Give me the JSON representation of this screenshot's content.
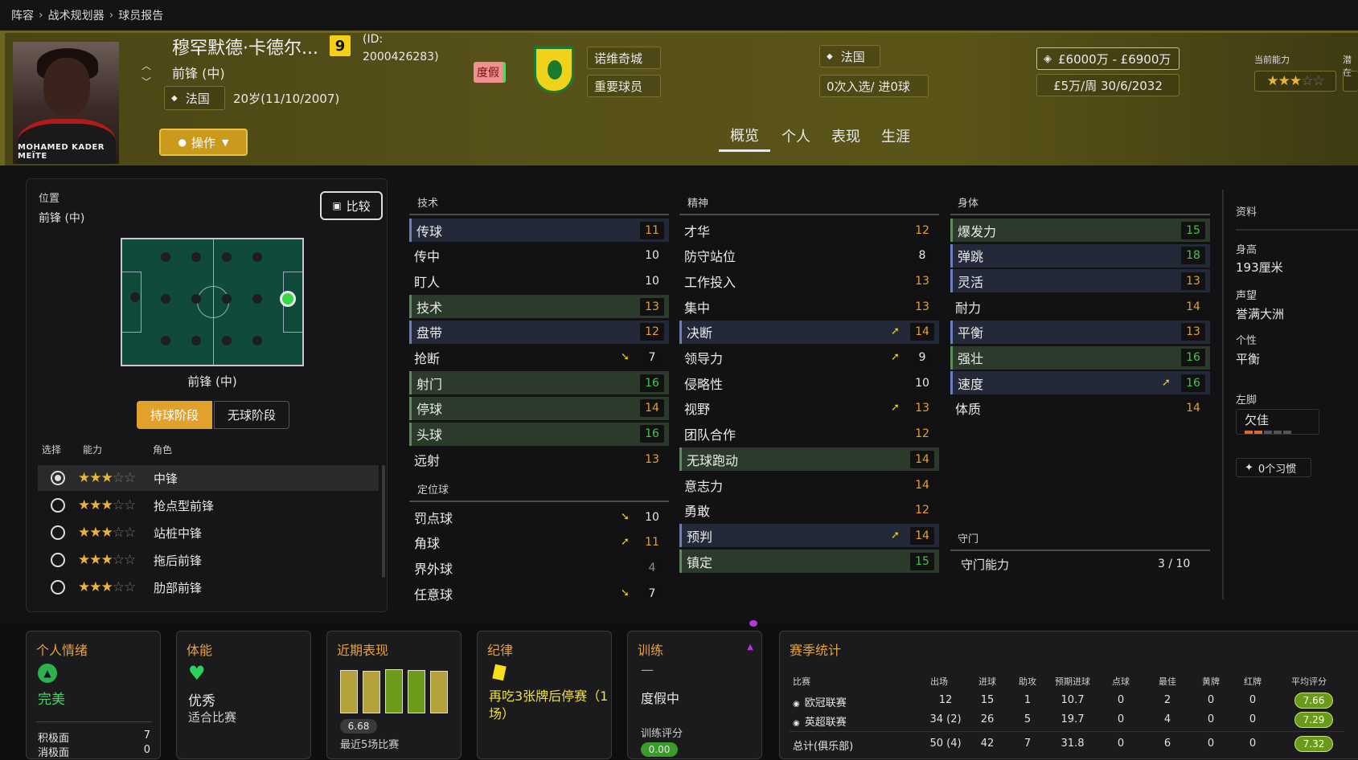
{
  "breadcrumb": [
    "阵容",
    "战术规划器",
    "球员报告"
  ],
  "player": {
    "name": "穆罕默德·卡德尔...",
    "number": "9",
    "id_label": "(ID:",
    "id_value": "2000426283)",
    "position": "前锋 (中)",
    "nation": "法国",
    "age": "20岁(11/10/2007)",
    "status_tag": "度假",
    "photo_caption": "MOHAMED KADER MEÏTE"
  },
  "club": {
    "name": "诺维奇城",
    "role": "重要球员"
  },
  "nation_box": {
    "country": "法国",
    "caps": "0次入选/ 进0球"
  },
  "value": {
    "range": "£6000万 - £6900万",
    "contract": "£5万/周 30/6/2032"
  },
  "ability": {
    "current_label": "当前能力",
    "potential_label": "潜在",
    "current_stars": 3
  },
  "action_button": "操作",
  "tabs": [
    "概览",
    "个人",
    "表现",
    "生涯"
  ],
  "left_panel": {
    "position_label": "位置",
    "position_value": "前锋 (中)",
    "compare_button": "比较",
    "pitch_label": "前锋 (中)",
    "phase_tabs": [
      "持球阶段",
      "无球阶段"
    ],
    "col_headers": [
      "选择",
      "能力",
      "角色"
    ],
    "roles": [
      {
        "name": "中锋",
        "stars": 3,
        "selected": true
      },
      {
        "name": "抢点型前锋",
        "stars": 3,
        "selected": false
      },
      {
        "name": "站桩中锋",
        "stars": 3,
        "selected": false
      },
      {
        "name": "拖后前锋",
        "stars": 3,
        "selected": false
      },
      {
        "name": "肋部前锋",
        "stars": 3,
        "selected": false
      }
    ]
  },
  "technical": {
    "title": "技术",
    "rows": [
      {
        "name": "传球",
        "value": "11",
        "hl": "blue",
        "arrow": ""
      },
      {
        "name": "传中",
        "value": "10",
        "hl": "",
        "arrow": ""
      },
      {
        "name": "盯人",
        "value": "10",
        "hl": "",
        "arrow": ""
      },
      {
        "name": "技术",
        "value": "13",
        "hl": "green",
        "arrow": ""
      },
      {
        "name": "盘带",
        "value": "12",
        "hl": "blue",
        "arrow": ""
      },
      {
        "name": "抢断",
        "value": "7",
        "hl": "",
        "arrow": "down"
      },
      {
        "name": "射门",
        "value": "16",
        "hl": "green",
        "arrow": ""
      },
      {
        "name": "停球",
        "value": "14",
        "hl": "green",
        "arrow": ""
      },
      {
        "name": "头球",
        "value": "16",
        "hl": "green",
        "arrow": ""
      },
      {
        "name": "远射",
        "value": "13",
        "hl": "",
        "arrow": ""
      }
    ]
  },
  "set_pieces": {
    "title": "定位球",
    "rows": [
      {
        "name": "罚点球",
        "value": "10",
        "hl": "",
        "arrow": "down"
      },
      {
        "name": "角球",
        "value": "11",
        "hl": "",
        "arrow": "up"
      },
      {
        "name": "界外球",
        "value": "4",
        "hl": "",
        "arrow": ""
      },
      {
        "name": "任意球",
        "value": "7",
        "hl": "",
        "arrow": "down"
      }
    ]
  },
  "mental": {
    "title": "精神",
    "rows": [
      {
        "name": "才华",
        "value": "12",
        "hl": "",
        "arrow": ""
      },
      {
        "name": "防守站位",
        "value": "8",
        "hl": "",
        "arrow": ""
      },
      {
        "name": "工作投入",
        "value": "13",
        "hl": "",
        "arrow": ""
      },
      {
        "name": "集中",
        "value": "13",
        "hl": "",
        "arrow": ""
      },
      {
        "name": "决断",
        "value": "14",
        "hl": "blue",
        "arrow": "up"
      },
      {
        "name": "领导力",
        "value": "9",
        "hl": "",
        "arrow": "up"
      },
      {
        "name": "侵略性",
        "value": "10",
        "hl": "",
        "arrow": ""
      },
      {
        "name": "视野",
        "value": "13",
        "hl": "",
        "arrow": "up"
      },
      {
        "name": "团队合作",
        "value": "12",
        "hl": "",
        "arrow": ""
      },
      {
        "name": "无球跑动",
        "value": "14",
        "hl": "green",
        "arrow": ""
      },
      {
        "name": "意志力",
        "value": "14",
        "hl": "",
        "arrow": ""
      },
      {
        "name": "勇敢",
        "value": "12",
        "hl": "",
        "arrow": ""
      },
      {
        "name": "预判",
        "value": "14",
        "hl": "blue",
        "arrow": "up"
      },
      {
        "name": "镇定",
        "value": "15",
        "hl": "green",
        "arrow": ""
      }
    ]
  },
  "physical": {
    "title": "身体",
    "rows": [
      {
        "name": "爆发力",
        "value": "15",
        "hl": "green",
        "arrow": ""
      },
      {
        "name": "弹跳",
        "value": "18",
        "hl": "blue",
        "arrow": ""
      },
      {
        "name": "灵活",
        "value": "13",
        "hl": "blue",
        "arrow": ""
      },
      {
        "name": "耐力",
        "value": "14",
        "hl": "",
        "arrow": ""
      },
      {
        "name": "平衡",
        "value": "13",
        "hl": "blue",
        "arrow": ""
      },
      {
        "name": "强壮",
        "value": "16",
        "hl": "green",
        "arrow": ""
      },
      {
        "name": "速度",
        "value": "16",
        "hl": "blue",
        "arrow": "up"
      },
      {
        "name": "体质",
        "value": "14",
        "hl": "",
        "arrow": ""
      }
    ]
  },
  "goalkeeping": {
    "title": "守门",
    "label": "守门能力",
    "value": "3 / 10"
  },
  "info": {
    "title": "资料",
    "height_label": "身高",
    "height": "193厘米",
    "rep_label": "声望",
    "rep": "誉满大洲",
    "personality_label": "个性",
    "personality": "平衡",
    "foot_label": "左脚",
    "foot": "欠佳",
    "habits": "0个习惯"
  },
  "cards": {
    "morale": {
      "title": "个人情绪",
      "value": "完美",
      "pos_label": "积极面",
      "pos": "7",
      "neg_label": "消极面",
      "neg": "0"
    },
    "fitness": {
      "title": "体能",
      "value": "优秀",
      "sub": "适合比赛"
    },
    "form": {
      "title": "近期表现",
      "rating": "6.68",
      "sub": "最近5场比赛",
      "bars": [
        0.9,
        0.88,
        0.92,
        0.9,
        0.88
      ]
    },
    "discipline": {
      "title": "纪律",
      "text": "再吃3张牌后停赛（1场）"
    },
    "training": {
      "title": "训练",
      "dash": "—",
      "status": "度假中",
      "rating_label": "训练评分",
      "rating": "0.00"
    },
    "season": {
      "title": "赛季统计",
      "headers": [
        "比赛",
        "出场",
        "进球",
        "助攻",
        "预期进球",
        "点球",
        "最佳",
        "黄牌",
        "红牌",
        "平均评分"
      ],
      "rows": [
        {
          "comp": "欧冠联赛",
          "vals": [
            "12",
            "15",
            "1",
            "10.7",
            "0",
            "2",
            "0",
            "0"
          ],
          "rating": "7.66"
        },
        {
          "comp": "英超联赛",
          "vals": [
            "34 (2)",
            "26",
            "5",
            "19.7",
            "0",
            "4",
            "0",
            "0"
          ],
          "rating": "7.29"
        },
        {
          "comp": "总计(俱乐部)",
          "vals": [
            "50 (4)",
            "42",
            "7",
            "31.8",
            "0",
            "6",
            "0",
            "0"
          ],
          "rating": "7.32"
        }
      ]
    }
  }
}
